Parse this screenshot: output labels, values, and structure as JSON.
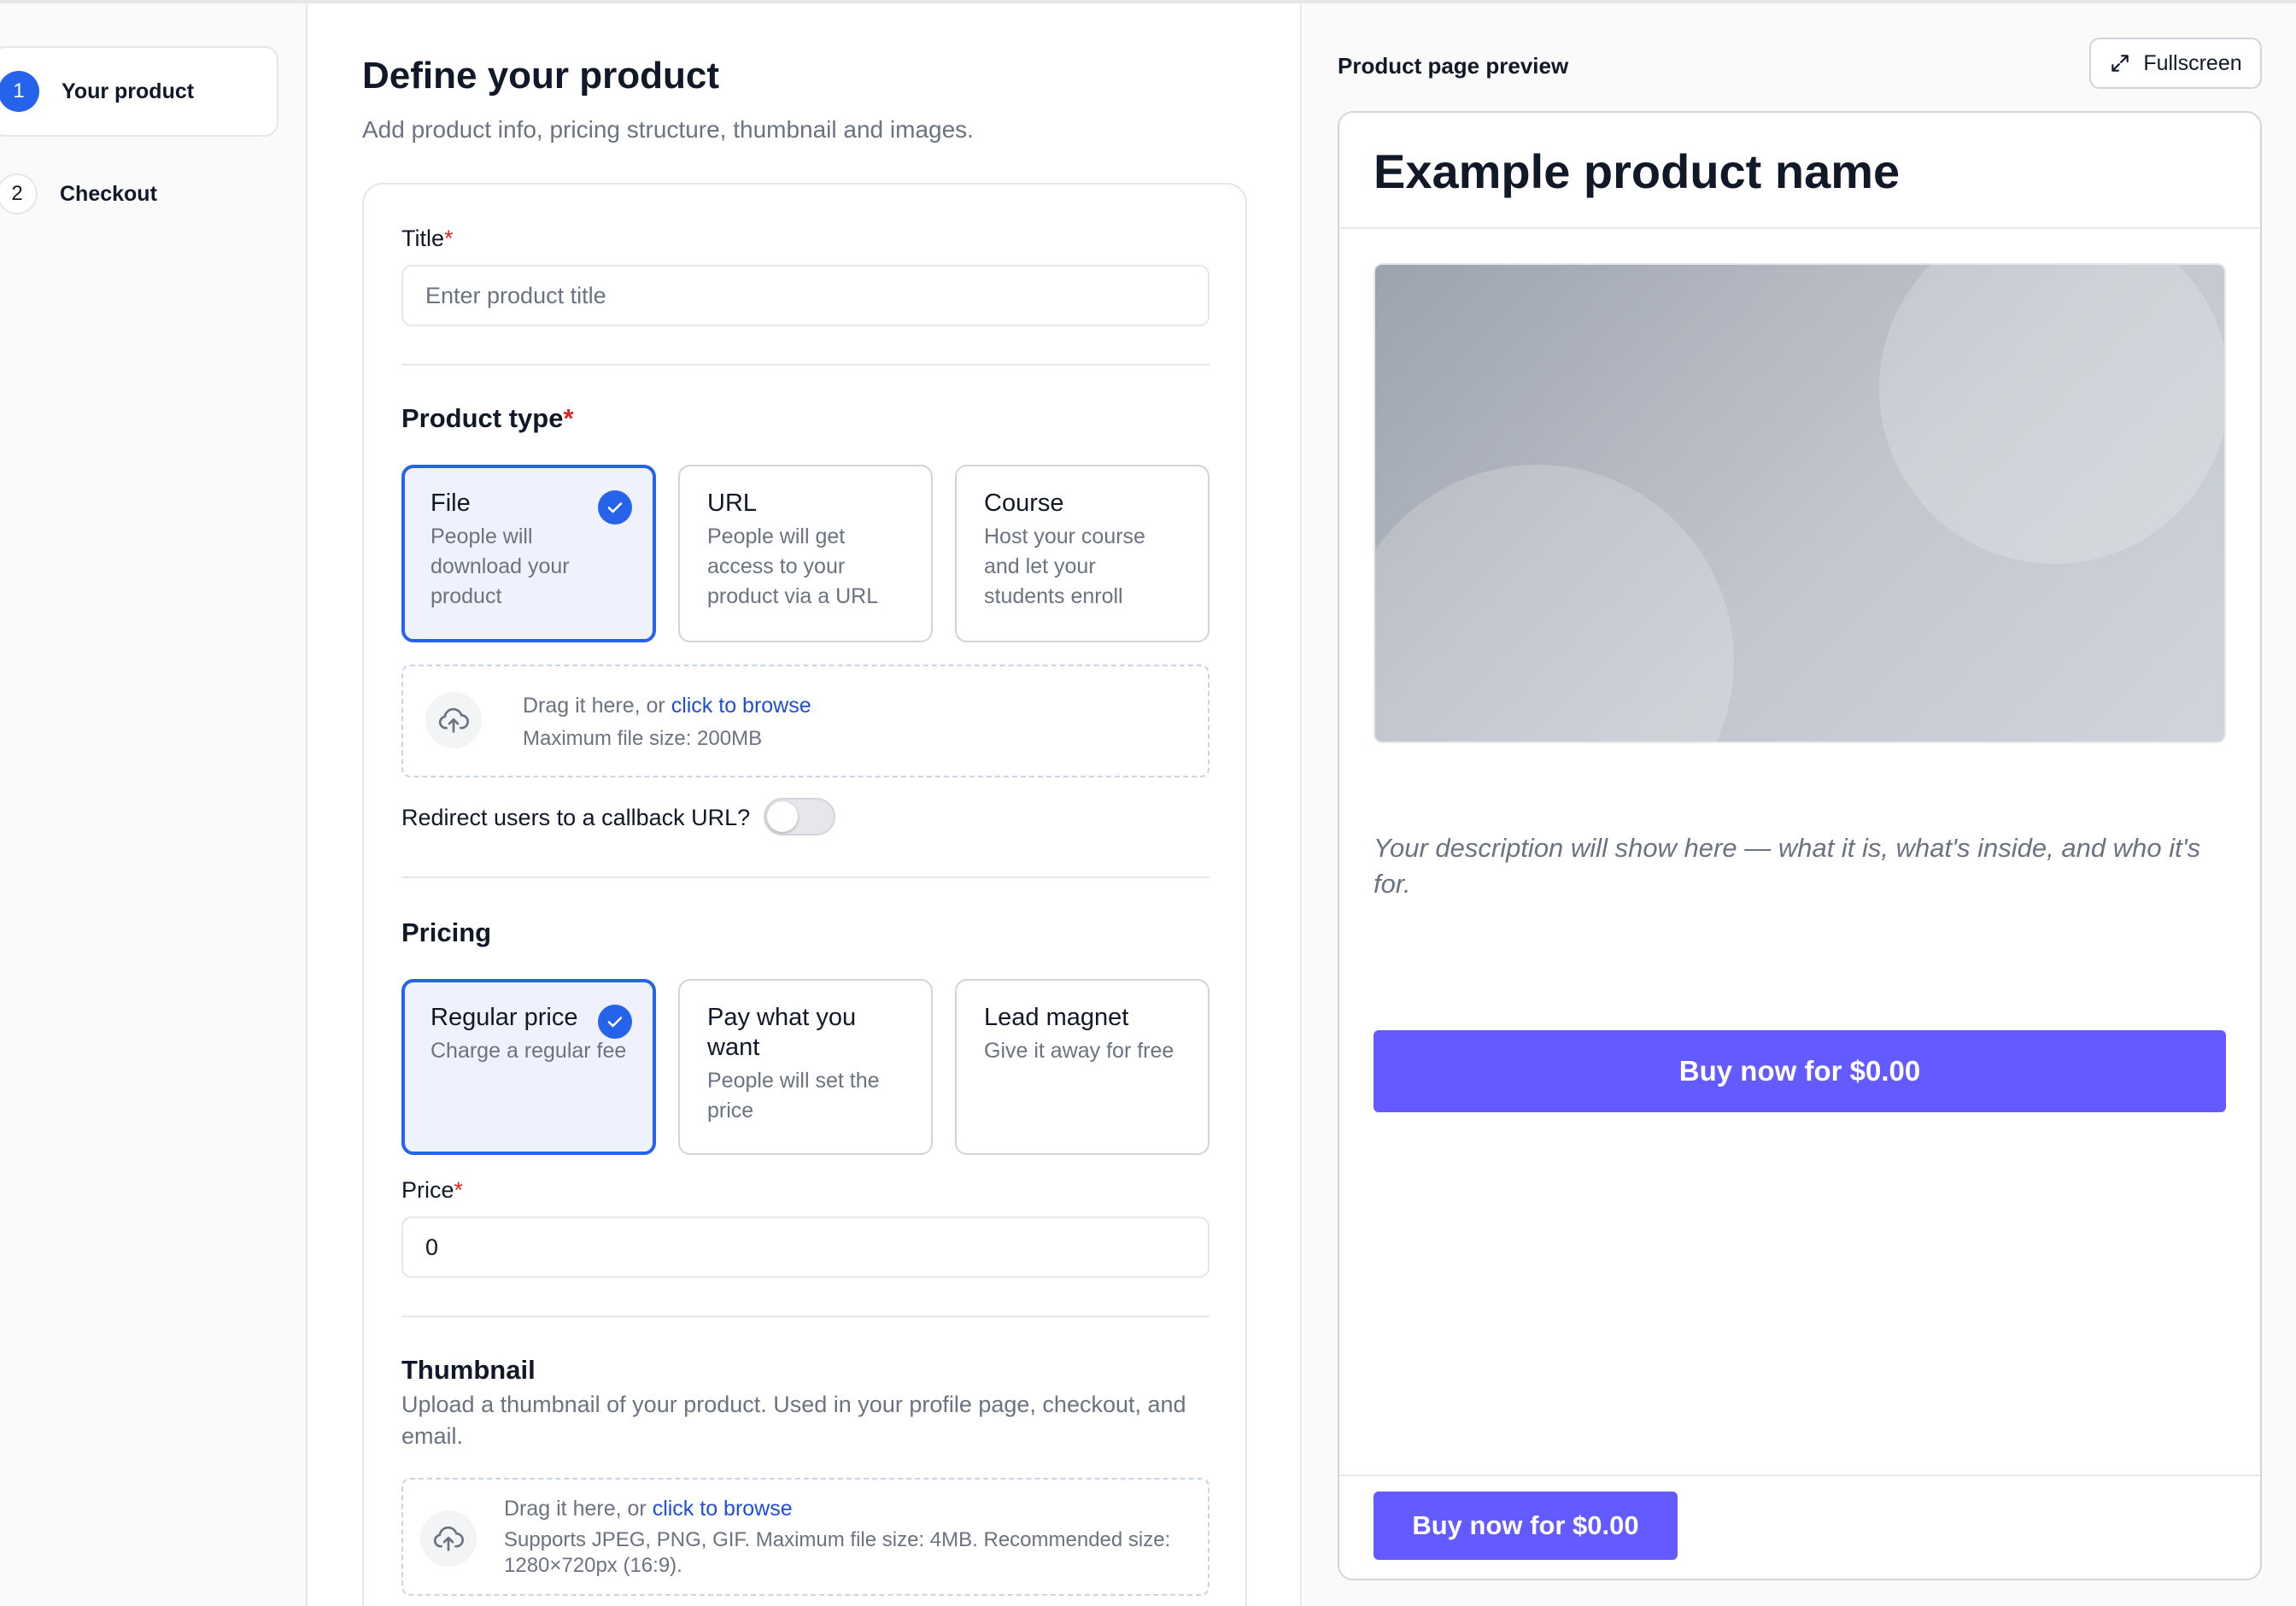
{
  "steps": [
    {
      "number": "1",
      "label": "Your product"
    },
    {
      "number": "2",
      "label": "Checkout"
    }
  ],
  "form": {
    "title": "Define your product",
    "subtitle": "Add product info, pricing structure, thumbnail and images.",
    "product_title": {
      "label": "Title",
      "required_mark": "*",
      "placeholder": "Enter product title",
      "value": ""
    },
    "product_type": {
      "title": "Product type",
      "required_mark": "*",
      "options": [
        {
          "title": "File",
          "desc": "People will download your product",
          "selected": true
        },
        {
          "title": "URL",
          "desc": "People will get access to your product via a URL",
          "selected": false
        },
        {
          "title": "Course",
          "desc": "Host your course and let your students enroll",
          "selected": false
        }
      ]
    },
    "file_upload": {
      "prefix": "Drag it here, or ",
      "link": "click to browse",
      "hint": "Maximum file size: 200MB"
    },
    "redirect": {
      "label": "Redirect users to a callback URL?",
      "enabled": false
    },
    "pricing": {
      "title": "Pricing",
      "options": [
        {
          "title": "Regular price",
          "desc": "Charge a regular fee",
          "selected": true
        },
        {
          "title": "Pay what you want",
          "desc": "People will set the price",
          "selected": false
        },
        {
          "title": "Lead magnet",
          "desc": "Give it away for free",
          "selected": false
        }
      ]
    },
    "price": {
      "label": "Price",
      "required_mark": "*",
      "value": "0"
    },
    "thumbnail": {
      "title": "Thumbnail",
      "desc": "Upload a thumbnail of your product. Used in your profile page, checkout, and email.",
      "upload_prefix": "Drag it here, or ",
      "upload_link": "click to browse",
      "upload_hint": "Supports JPEG, PNG, GIF. Maximum file size: 4MB. Recommended size: 1280×720px (16:9)."
    }
  },
  "preview": {
    "label": "Product page preview",
    "fullscreen_label": "Fullscreen",
    "product_name": "Example product name",
    "description": "Your description will show here — what it is, what's inside, and who it's for.",
    "buy_label": "Buy now for $0.00",
    "buy_label_footer": "Buy now for $0.00"
  },
  "colors": {
    "accent": "#2563eb",
    "buy_button": "#635bff",
    "required": "#dc2626",
    "link": "#1d4ed8"
  },
  "icons": {
    "check": "checkmark-icon",
    "upload": "cloud-upload-icon",
    "fullscreen": "expand-arrows-icon"
  }
}
